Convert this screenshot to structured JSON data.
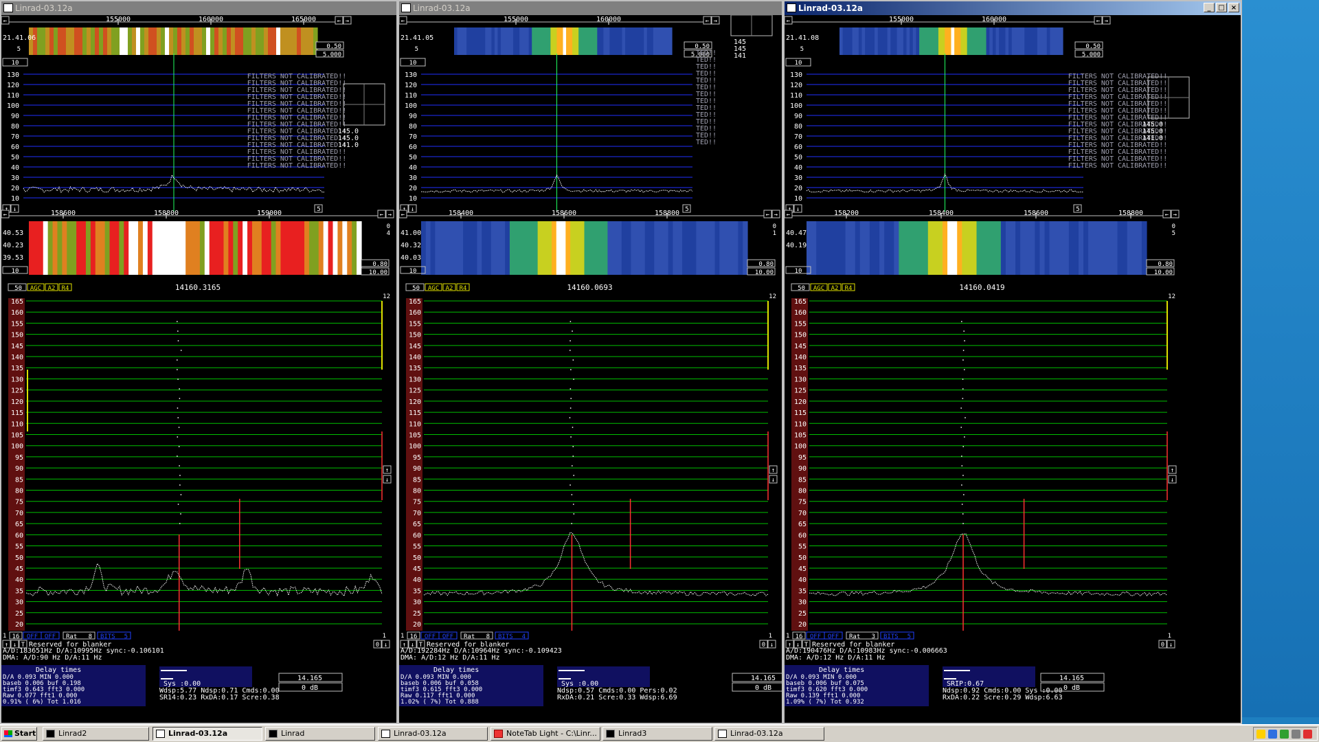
{
  "windows": [
    {
      "title": "Linrad-03.12a",
      "active": false,
      "wf1": {
        "ticks": [
          "155000",
          "160000",
          "165000"
        ],
        "time": "21.41.06",
        "lbl_a": "0.50",
        "lbl_b": "5.000",
        "left_a": "5",
        "left_b": "10",
        "style": "wide"
      },
      "spec1": {
        "yticks": [
          "130",
          "120",
          "110",
          "100",
          "90",
          "80",
          "70",
          "60",
          "50",
          "40",
          "30",
          "20",
          "10"
        ],
        "corner": "5"
      },
      "filters_text": "FILTERS NOT CALIBRATED!!",
      "side": {
        "s": "145.0",
        "m": "145.0",
        "o": "141.0"
      },
      "wf2": {
        "ticks": [
          "158600",
          "158800",
          "159000"
        ],
        "times": [
          "40.53",
          "40.23",
          "39.53"
        ],
        "lbl_a": "0.80",
        "lbl_b": "10.00",
        "left": "10",
        "right_top": "0",
        "right_bot": "4"
      },
      "controls": {
        "a": "50",
        "agc": "AGC",
        "a2": "A2",
        "r4": "R4",
        "freq": "14160.3165",
        "right": "12"
      },
      "spec2_ticks": [
        "165",
        "160",
        "155",
        "150",
        "145",
        "140",
        "135",
        "130",
        "125",
        "120",
        "115",
        "110",
        "105",
        "100",
        "95",
        "90",
        "85",
        "80",
        "75",
        "70",
        "65",
        "60",
        "55",
        "50",
        "45",
        "40",
        "35",
        "30",
        "25",
        "20"
      ],
      "bottom": {
        "b1": "1",
        "b2": "16",
        "off1": "OFF",
        "off2": "OFF",
        "rat": "Rat",
        "rat_val": "8",
        "bits_label": "BITS",
        "bits_val": "5",
        "reserved": "Reserved for blanker",
        "zero": "0",
        "one": "1"
      },
      "status": {
        "line1": "A/D:183651Hz  D/A:10995Hz sync:-0.106101",
        "line2": "DMA:  A/D:90 Hz    D/A:11 Hz",
        "delay_title": "Delay times",
        "delay_rows": [
          "D/A    0.093  MIN   0.000",
          "baseb  0.006  buf   0.198",
          "timf3  0.643  fft3  0.000",
          "  Raw  0.077  fft1  0.000",
          "0.91%  ( 6%)  Tot   1.016"
        ],
        "freq": "14.165",
        "db": "0 dB",
        "stats": [
          "Sys :0.00",
          "Wdsp:5.77   Ndsp:0.71  Cmds:0.00",
          "SR14:0.23   RxDA:0.17  Scre:0.38"
        ]
      }
    },
    {
      "title": "Linrad-03.12a",
      "active": false,
      "wf1": {
        "ticks": [
          "155000",
          "160000"
        ],
        "time": "21.41.05",
        "lbl_a": "0.50",
        "lbl_b": "5.000",
        "left_a": "5",
        "left_b": "10",
        "style": "narrow"
      },
      "spec1": {
        "yticks": [
          "130",
          "120",
          "110",
          "100",
          "90",
          "80",
          "70",
          "60",
          "50",
          "40",
          "30",
          "20",
          "10"
        ],
        "corner": "5"
      },
      "filters_text": "TED!!",
      "side": {
        "s": "145",
        "m": "145",
        "o": "141"
      },
      "wf2": {
        "ticks": [
          "158400",
          "158600",
          "158800"
        ],
        "times": [
          "41.00",
          "40.32",
          "40.03"
        ],
        "lbl_a": "0.80",
        "lbl_b": "10.00",
        "left": "10",
        "right_top": "0",
        "right_bot": "1"
      },
      "controls": {
        "a": "50",
        "agc": "AGC",
        "a2": "A2",
        "r4": "R4",
        "freq": "14160.0693",
        "right": "12"
      },
      "spec2_ticks": [
        "165",
        "160",
        "155",
        "150",
        "145",
        "140",
        "135",
        "130",
        "125",
        "120",
        "115",
        "110",
        "105",
        "100",
        "95",
        "90",
        "85",
        "80",
        "75",
        "70",
        "65",
        "60",
        "55",
        "50",
        "45",
        "40",
        "35",
        "30",
        "25",
        "20"
      ],
      "bottom": {
        "b1": "1",
        "b2": "16",
        "off1": "OFF",
        "off2": "OFF",
        "rat": "Rat",
        "rat_val": "8",
        "bits_label": "BITS",
        "bits_val": "4",
        "reserved": "Reserved for blanker",
        "zero": "0",
        "one": "1"
      },
      "status": {
        "line1": "A/D:192284Hz  D/A:10964Hz sync:-0.109423",
        "line2": "DMA:  A/D:12 Hz    D/A:11 Hz",
        "delay_title": "Delay times",
        "delay_rows": [
          "D/A    0.093  MIN   0.000",
          "baseb  0.006  buf   0.058",
          "timf3  0.615  fft3  0.000",
          "  Raw  0.117  fft1  0.000",
          "1.02%  ( 7%)  Tot   0.888"
        ],
        "freq": "14.165",
        "db": "0 dB",
        "stats": [
          "Sys :0.00",
          "Ndsp:0.57   Cmds:0.00  Pers:0.02",
          "RxDA:0.21   Scre:0.33  Wdsp:6.69"
        ]
      }
    },
    {
      "title": "Linrad-03.12a",
      "active": true,
      "wf1": {
        "ticks": [
          "155000",
          "160000"
        ],
        "time": "21.41.08",
        "lbl_a": "0.50",
        "lbl_b": "5.000",
        "left_a": "5",
        "left_b": "10",
        "style": "narrow"
      },
      "spec1": {
        "yticks": [
          "130",
          "120",
          "110",
          "100",
          "90",
          "80",
          "70",
          "60",
          "50",
          "40",
          "30",
          "20",
          "10"
        ],
        "corner": "5"
      },
      "filters_text": "FILTERS NOT CALIBRATED!!",
      "side": {
        "s": "145.0",
        "m": "145.0",
        "o": "141.0"
      },
      "wf2": {
        "ticks": [
          "158200",
          "158400",
          "158600",
          "158800"
        ],
        "times": [
          "40.47",
          "40.19"
        ],
        "lbl_a": "0.80",
        "lbl_b": "10.00",
        "left": "10",
        "right_top": "0",
        "right_bot": "5"
      },
      "controls": {
        "a": "50",
        "agc": "AGC",
        "a2": "A2",
        "r4": "R4",
        "freq": "14160.0419",
        "right": "12"
      },
      "spec2_ticks": [
        "165",
        "160",
        "155",
        "150",
        "145",
        "140",
        "135",
        "130",
        "125",
        "120",
        "115",
        "110",
        "105",
        "100",
        "95",
        "90",
        "85",
        "80",
        "75",
        "70",
        "65",
        "60",
        "55",
        "50",
        "45",
        "40",
        "35",
        "30",
        "25",
        "20"
      ],
      "bottom": {
        "b1": "1",
        "b2": "16",
        "off1": "OFF",
        "off2": "OFF",
        "rat": "Rat",
        "rat_val": "3",
        "bits_label": "BITS",
        "bits_val": "5",
        "reserved": "Reserved for blanker",
        "zero": "0",
        "one": "1"
      },
      "status": {
        "line1": "A/D:190476Hz  D/A:10983Hz sync:-0.006663",
        "line2": "DMA:  A/D:12 Hz    D/A:11 Hz",
        "delay_title": "Delay times",
        "delay_rows": [
          "D/A    0.093  MIN   0.000",
          "baseb  0.006  buf   0.075",
          "timf3  0.620  fft3  0.000",
          "  Raw  0.139  fft1  0.000",
          "1.09%  ( 7%)  Tot   0.932"
        ],
        "freq": "14.165",
        "db": "0 dB",
        "stats": [
          "SRIP:0.67",
          "Ndsp:0.92   Cmds:0.00  Sys :0.00",
          "RxDA:0.22   Scre:0.29  Wdsp:6.63"
        ]
      }
    }
  ],
  "taskbar": {
    "start": "Start",
    "tasks": [
      {
        "label": "Linrad2",
        "icon": "cmd",
        "pressed": false
      },
      {
        "label": "Linrad-03.12a",
        "icon": "window",
        "pressed": true
      },
      {
        "label": "Linrad",
        "icon": "cmd",
        "pressed": false
      },
      {
        "label": "Linrad-03.12a",
        "icon": "window",
        "pressed": false
      },
      {
        "label": "NoteTab Light  - C:\\Linr...",
        "icon": "note",
        "pressed": false
      },
      {
        "label": "Linrad3",
        "icon": "cmd",
        "pressed": false
      },
      {
        "label": "Linrad-03.12a",
        "icon": "window",
        "pressed": false
      }
    ],
    "tray_icons": [
      "tray-icon-1",
      "tray-icon-2",
      "tray-icon-3",
      "tray-icon-4",
      "tray-icon-5"
    ]
  },
  "colors": {
    "green_grid": "#00c000",
    "blue_grid": "#2030ff",
    "trace": "#ffffff",
    "marker": "#ff3030",
    "label": "#ffffff",
    "accent_yellow": "#e0e000"
  }
}
